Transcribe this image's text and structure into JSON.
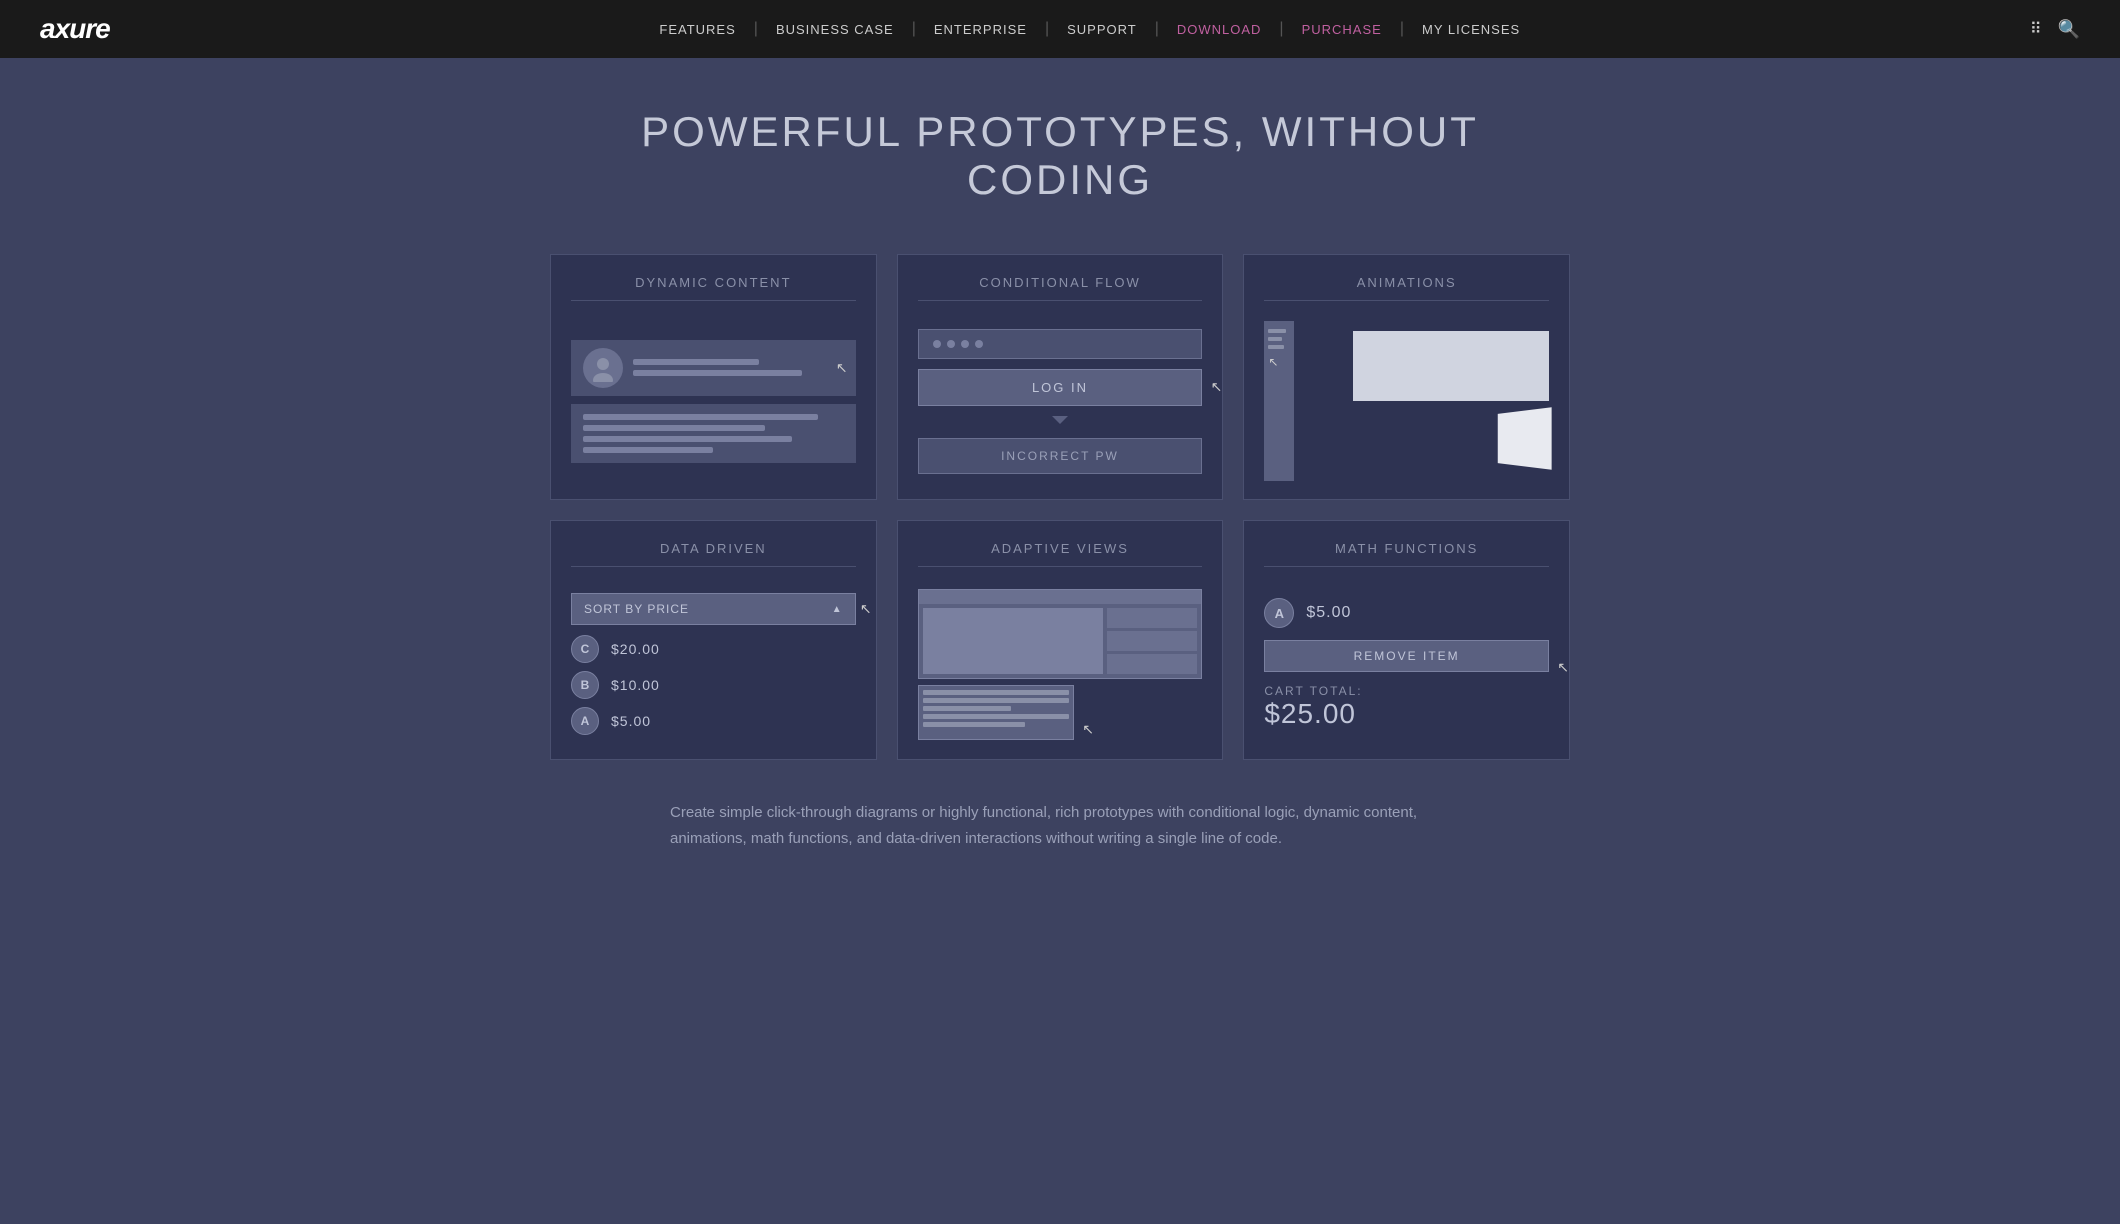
{
  "nav": {
    "logo": "axure",
    "links": [
      {
        "label": "FEATURES",
        "href": "#",
        "class": ""
      },
      {
        "label": "BUSINESS CASE",
        "href": "#",
        "class": ""
      },
      {
        "label": "ENTERPRISE",
        "href": "#",
        "class": ""
      },
      {
        "label": "SUPPORT",
        "href": "#",
        "class": ""
      },
      {
        "label": "DOWNLOAD",
        "href": "#",
        "class": "download"
      },
      {
        "label": "PURCHASE",
        "href": "#",
        "class": "purchase"
      },
      {
        "label": "MY LICENSES",
        "href": "#",
        "class": ""
      }
    ]
  },
  "hero": {
    "title": "POWERFUL PROTOTYPES, WITHOUT CODING"
  },
  "cards": [
    {
      "id": "dynamic-content",
      "title": "DYNAMIC CONTENT"
    },
    {
      "id": "conditional-flow",
      "title": "CONDITIONAL FLOW",
      "login_label": "LOG IN",
      "error_label": "INCORRECT PW"
    },
    {
      "id": "animations",
      "title": "ANIMATIONS"
    },
    {
      "id": "data-driven",
      "title": "DATA DRIVEN",
      "sort_label": "SORT BY PRICE",
      "items": [
        {
          "badge": "C",
          "price": "$20.00"
        },
        {
          "badge": "B",
          "price": "$10.00"
        },
        {
          "badge": "A",
          "price": "$5.00"
        }
      ]
    },
    {
      "id": "adaptive-views",
      "title": "ADAPTIVE VIEWS"
    },
    {
      "id": "math-functions",
      "title": "MATH FUNCTIONS",
      "item_badge": "A",
      "item_price": "$5.00",
      "remove_label": "REMOVE ITEM",
      "total_label": "CART TOTAL:",
      "total_amount": "$25.00"
    }
  ],
  "description": "Create simple click-through diagrams or highly functional, rich prototypes with conditional logic, dynamic content, animations, math functions, and data-driven interactions without writing a single line of code."
}
